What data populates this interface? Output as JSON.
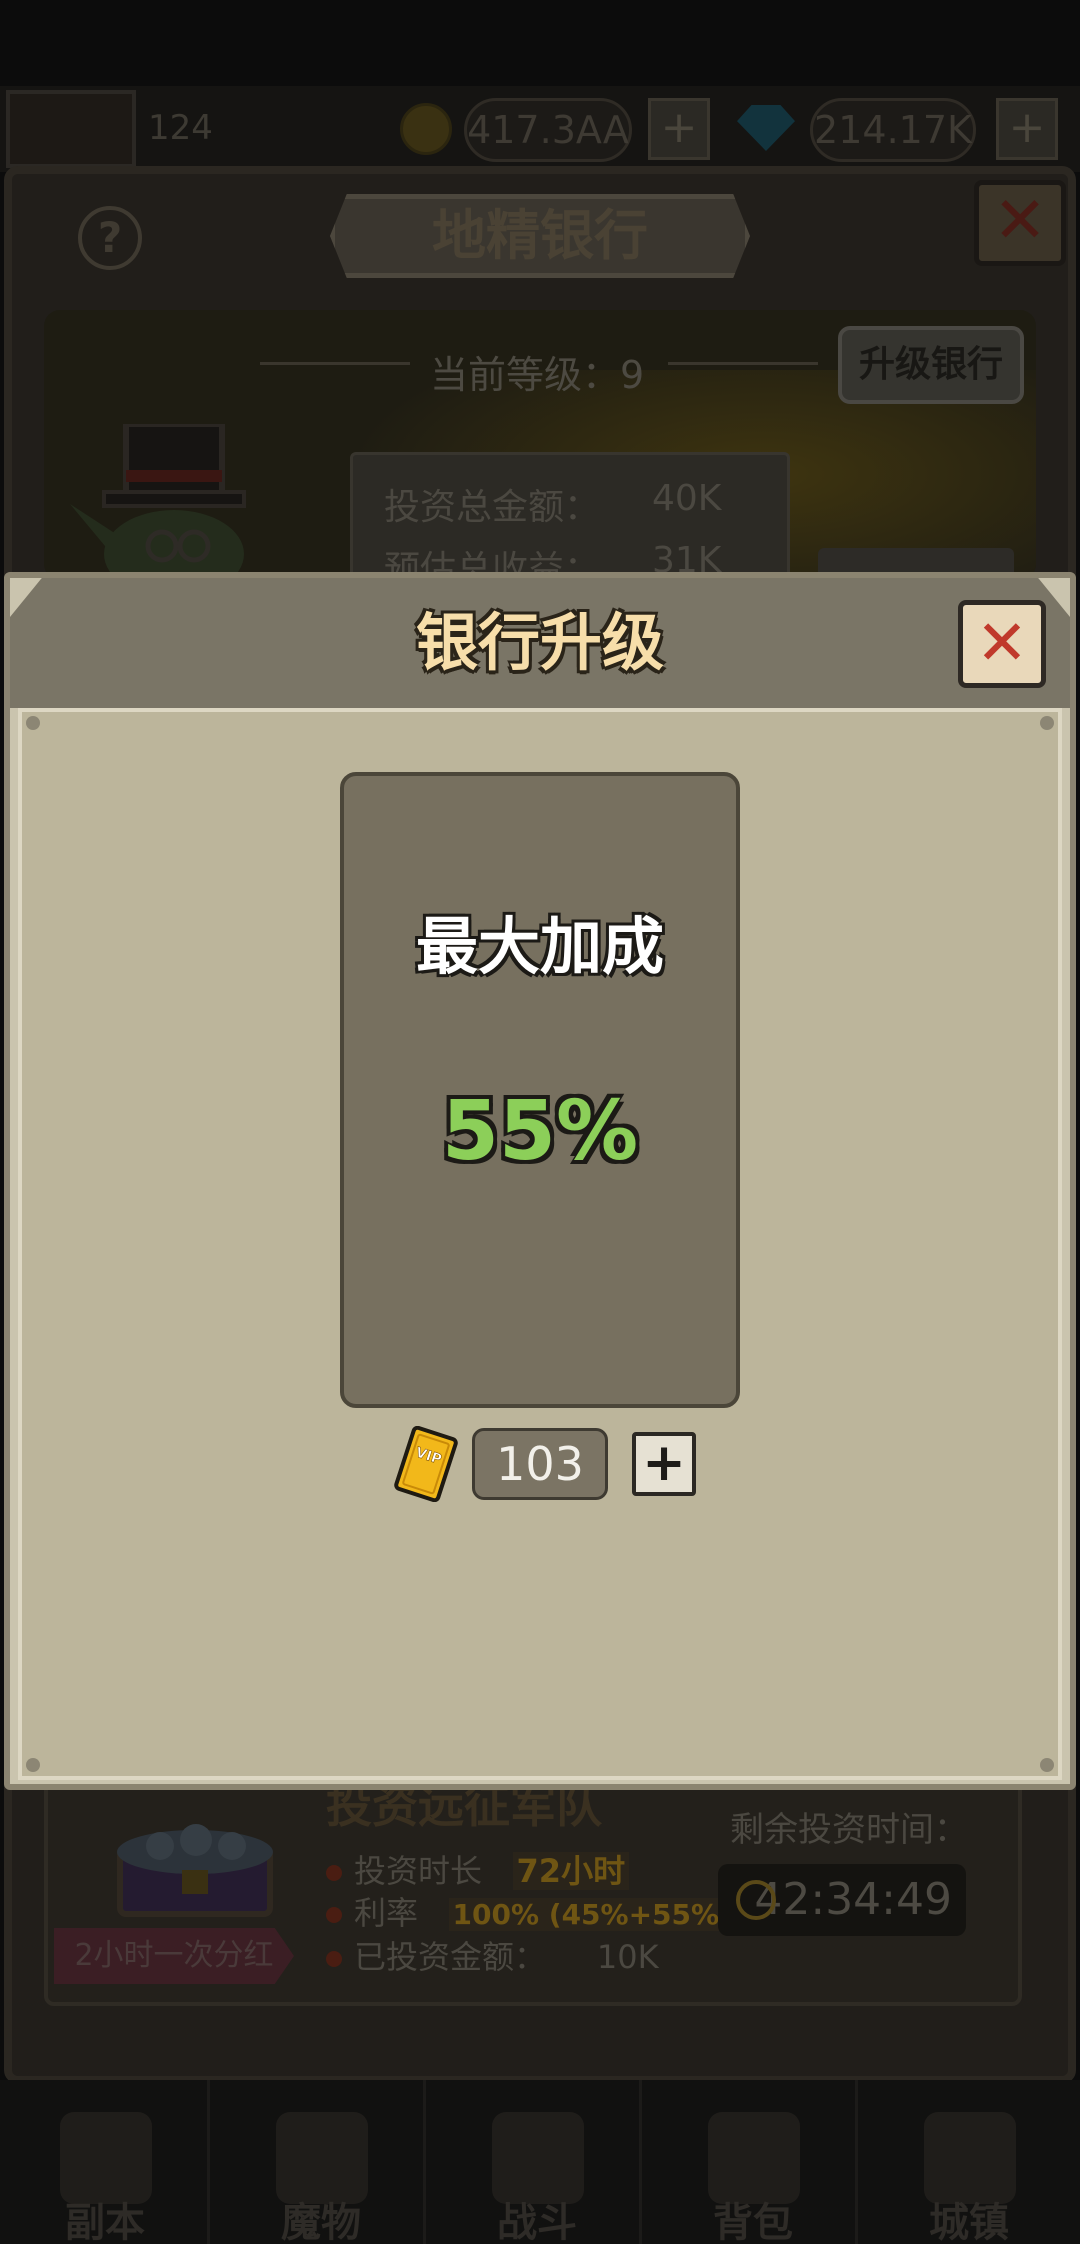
{
  "top_bar": {
    "level": "124",
    "gold": "417.3AA",
    "gems": "214.17K",
    "add_gold_label": "+",
    "add_gems_label": "+",
    "coin_icon": "gold-coin-icon",
    "gem_icon": "diamond-icon"
  },
  "bank": {
    "title": "地精银行",
    "help_label": "?",
    "close_label": "✕",
    "current_level_label": "当前等级：",
    "current_level": "9",
    "upgrade_button": "升级银行",
    "total_invest_label": "投资总金额：",
    "total_invest_value": "40K",
    "estimated_income_label": "预估总收益：",
    "estimated_income_value": "31K"
  },
  "expedition": {
    "title": "投资远征军队",
    "duration_label": "投资时长",
    "duration_value": "72小时",
    "rate_label": "利率",
    "rate_value": "100% (45%+55%)",
    "invested_label": "已投资金额：",
    "invested_value": "10K",
    "dividend_ribbon": "2小时一次分红",
    "remaining_label": "剩余投资时间：",
    "remaining_time": "42:34:49"
  },
  "bottom_nav": [
    {
      "label": "副本",
      "icon": "dungeon-map-icon"
    },
    {
      "label": "魔物",
      "icon": "monster-helmet-icon"
    },
    {
      "label": "战斗",
      "icon": "crossed-swords-icon"
    },
    {
      "label": "背包",
      "icon": "backpack-icon"
    },
    {
      "label": "城镇",
      "icon": "town-shop-icon"
    }
  ],
  "upgrade_modal": {
    "title": "银行升级",
    "close_label": "✕",
    "bonus_label": "最大加成",
    "bonus_value": "55%",
    "vip_card_icon": "vip-card-icon",
    "vip_count": "103",
    "add_label": "+"
  },
  "colors": {
    "bonus_green": "#8ccf59",
    "title_gold": "#f7deaa",
    "close_red": "#c0392b",
    "vip_gold": "#f2b81a"
  }
}
